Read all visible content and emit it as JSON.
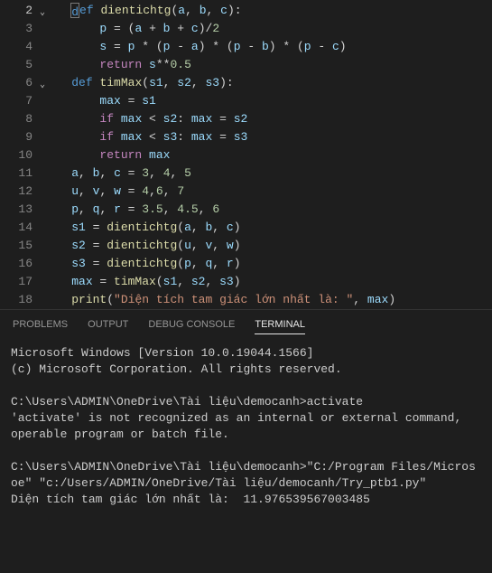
{
  "editor": {
    "lines": [
      {
        "num": "2",
        "fold": true,
        "tokens": [
          [
            "",
            "    "
          ],
          [
            "kw",
            "def"
          ],
          [
            "",
            " "
          ],
          [
            "fn",
            "dientichtg"
          ],
          [
            "",
            "("
          ],
          [
            "var",
            "a"
          ],
          [
            "",
            ", "
          ],
          [
            "var",
            "b"
          ],
          [
            "",
            ", "
          ],
          [
            "var",
            "c"
          ],
          [
            "",
            "):"
          ]
        ]
      },
      {
        "num": "3",
        "tokens": [
          [
            "",
            "        "
          ],
          [
            "var",
            "p"
          ],
          [
            "",
            " = ("
          ],
          [
            "var",
            "a"
          ],
          [
            "",
            " + "
          ],
          [
            "var",
            "b"
          ],
          [
            "",
            " + "
          ],
          [
            "var",
            "c"
          ],
          [
            "",
            ")/"
          ],
          [
            "num",
            "2"
          ]
        ]
      },
      {
        "num": "4",
        "tokens": [
          [
            "",
            "        "
          ],
          [
            "var",
            "s"
          ],
          [
            "",
            " = "
          ],
          [
            "var",
            "p"
          ],
          [
            "",
            " * ("
          ],
          [
            "var",
            "p"
          ],
          [
            "",
            " - "
          ],
          [
            "var",
            "a"
          ],
          [
            "",
            ") * ("
          ],
          [
            "var",
            "p"
          ],
          [
            "",
            " - "
          ],
          [
            "var",
            "b"
          ],
          [
            "",
            ") * ("
          ],
          [
            "var",
            "p"
          ],
          [
            "",
            " - "
          ],
          [
            "var",
            "c"
          ],
          [
            "",
            ")"
          ]
        ]
      },
      {
        "num": "5",
        "tokens": [
          [
            "",
            "        "
          ],
          [
            "flow",
            "return"
          ],
          [
            "",
            " "
          ],
          [
            "var",
            "s"
          ],
          [
            "",
            "**"
          ],
          [
            "num",
            "0.5"
          ]
        ]
      },
      {
        "num": "6",
        "fold": true,
        "tokens": [
          [
            "",
            "    "
          ],
          [
            "kw",
            "def"
          ],
          [
            "",
            " "
          ],
          [
            "fn",
            "timMax"
          ],
          [
            "",
            "("
          ],
          [
            "var",
            "s1"
          ],
          [
            "",
            ", "
          ],
          [
            "var",
            "s2"
          ],
          [
            "",
            ", "
          ],
          [
            "var",
            "s3"
          ],
          [
            "",
            "):"
          ]
        ]
      },
      {
        "num": "7",
        "tokens": [
          [
            "",
            "        "
          ],
          [
            "var",
            "max"
          ],
          [
            "",
            " = "
          ],
          [
            "var",
            "s1"
          ]
        ]
      },
      {
        "num": "8",
        "tokens": [
          [
            "",
            "        "
          ],
          [
            "flow",
            "if"
          ],
          [
            "",
            " "
          ],
          [
            "var",
            "max"
          ],
          [
            "",
            " < "
          ],
          [
            "var",
            "s2"
          ],
          [
            "",
            ": "
          ],
          [
            "var",
            "max"
          ],
          [
            "",
            " = "
          ],
          [
            "var",
            "s2"
          ]
        ]
      },
      {
        "num": "9",
        "tokens": [
          [
            "",
            "        "
          ],
          [
            "flow",
            "if"
          ],
          [
            "",
            " "
          ],
          [
            "var",
            "max"
          ],
          [
            "",
            " < "
          ],
          [
            "var",
            "s3"
          ],
          [
            "",
            ": "
          ],
          [
            "var",
            "max"
          ],
          [
            "",
            " = "
          ],
          [
            "var",
            "s3"
          ]
        ]
      },
      {
        "num": "10",
        "tokens": [
          [
            "",
            "        "
          ],
          [
            "flow",
            "return"
          ],
          [
            "",
            " "
          ],
          [
            "var",
            "max"
          ]
        ]
      },
      {
        "num": "11",
        "tokens": [
          [
            "",
            "    "
          ],
          [
            "var",
            "a"
          ],
          [
            "",
            ", "
          ],
          [
            "var",
            "b"
          ],
          [
            "",
            ", "
          ],
          [
            "var",
            "c"
          ],
          [
            "",
            " = "
          ],
          [
            "num",
            "3"
          ],
          [
            "",
            ", "
          ],
          [
            "num",
            "4"
          ],
          [
            "",
            ", "
          ],
          [
            "num",
            "5"
          ]
        ]
      },
      {
        "num": "12",
        "tokens": [
          [
            "",
            "    "
          ],
          [
            "var",
            "u"
          ],
          [
            "",
            ", "
          ],
          [
            "var",
            "v"
          ],
          [
            "",
            ", "
          ],
          [
            "var",
            "w"
          ],
          [
            "",
            " = "
          ],
          [
            "num",
            "4"
          ],
          [
            "",
            ","
          ],
          [
            "num",
            "6"
          ],
          [
            "",
            ", "
          ],
          [
            "num",
            "7"
          ]
        ]
      },
      {
        "num": "13",
        "tokens": [
          [
            "",
            "    "
          ],
          [
            "var",
            "p"
          ],
          [
            "",
            ", "
          ],
          [
            "var",
            "q"
          ],
          [
            "",
            ", "
          ],
          [
            "var",
            "r"
          ],
          [
            "",
            " = "
          ],
          [
            "num",
            "3.5"
          ],
          [
            "",
            ", "
          ],
          [
            "num",
            "4.5"
          ],
          [
            "",
            ", "
          ],
          [
            "num",
            "6"
          ]
        ]
      },
      {
        "num": "14",
        "tokens": [
          [
            "",
            "    "
          ],
          [
            "var",
            "s1"
          ],
          [
            "",
            " = "
          ],
          [
            "fn",
            "dientichtg"
          ],
          [
            "",
            "("
          ],
          [
            "var",
            "a"
          ],
          [
            "",
            ", "
          ],
          [
            "var",
            "b"
          ],
          [
            "",
            ", "
          ],
          [
            "var",
            "c"
          ],
          [
            "",
            ")"
          ]
        ]
      },
      {
        "num": "15",
        "tokens": [
          [
            "",
            "    "
          ],
          [
            "var",
            "s2"
          ],
          [
            "",
            " = "
          ],
          [
            "fn",
            "dientichtg"
          ],
          [
            "",
            "("
          ],
          [
            "var",
            "u"
          ],
          [
            "",
            ", "
          ],
          [
            "var",
            "v"
          ],
          [
            "",
            ", "
          ],
          [
            "var",
            "w"
          ],
          [
            "",
            ")"
          ]
        ]
      },
      {
        "num": "16",
        "tokens": [
          [
            "",
            "    "
          ],
          [
            "var",
            "s3"
          ],
          [
            "",
            " = "
          ],
          [
            "fn",
            "dientichtg"
          ],
          [
            "",
            "("
          ],
          [
            "var",
            "p"
          ],
          [
            "",
            ", "
          ],
          [
            "var",
            "q"
          ],
          [
            "",
            ", "
          ],
          [
            "var",
            "r"
          ],
          [
            "",
            ")"
          ]
        ]
      },
      {
        "num": "17",
        "tokens": [
          [
            "",
            "    "
          ],
          [
            "var",
            "max"
          ],
          [
            "",
            " = "
          ],
          [
            "fn",
            "timMax"
          ],
          [
            "",
            "("
          ],
          [
            "var",
            "s1"
          ],
          [
            "",
            ", "
          ],
          [
            "var",
            "s2"
          ],
          [
            "",
            ", "
          ],
          [
            "var",
            "s3"
          ],
          [
            "",
            ")"
          ]
        ]
      },
      {
        "num": "18",
        "tokens": [
          [
            "",
            "    "
          ],
          [
            "fn",
            "print"
          ],
          [
            "",
            "("
          ],
          [
            "str",
            "\"Diện tích tam giác lớn nhất là: \""
          ],
          [
            "",
            ", "
          ],
          [
            "var",
            "max"
          ],
          [
            "",
            ")"
          ]
        ]
      }
    ]
  },
  "panel": {
    "tabs": [
      "PROBLEMS",
      "OUTPUT",
      "DEBUG CONSOLE",
      "TERMINAL"
    ],
    "active": 3,
    "terminal": "Microsoft Windows [Version 10.0.19044.1566]\n(c) Microsoft Corporation. All rights reserved.\n\nC:\\Users\\ADMIN\\OneDrive\\Tài liệu\\democanh>activate\n'activate' is not recognized as an internal or external command,\noperable program or batch file.\n\nC:\\Users\\ADMIN\\OneDrive\\Tài liệu\\democanh>\"C:/Program Files/Microsoe\" \"c:/Users/ADMIN/OneDrive/Tài liệu/democanh/Try_ptb1.py\"\nDiện tích tam giác lớn nhất là:  11.976539567003485"
  }
}
